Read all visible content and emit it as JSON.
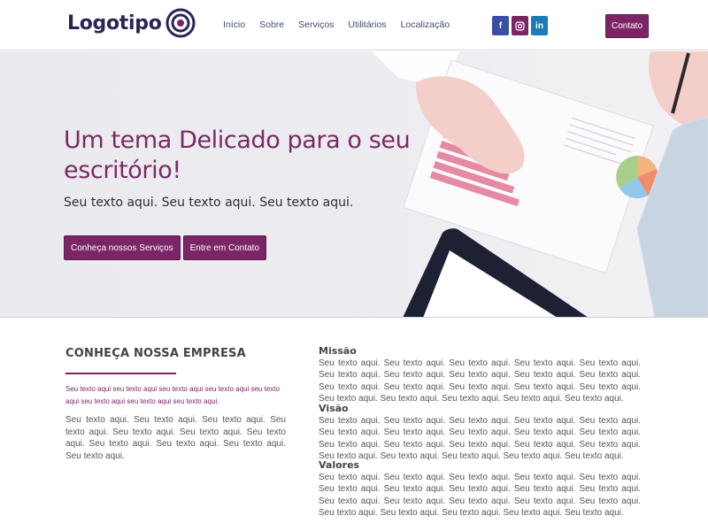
{
  "header": {
    "logo_text": "Logotipo",
    "nav": [
      "Início",
      "Sobre",
      "Serviços",
      "Utilitários",
      "Localização"
    ],
    "social": [
      {
        "icon": "facebook-icon",
        "glyph": "f"
      },
      {
        "icon": "instagram-icon",
        "glyph": ""
      },
      {
        "icon": "linkedin-icon",
        "glyph": "in"
      }
    ],
    "contact_label": "Contato"
  },
  "hero": {
    "title": "Um tema Delicado para o seu escritório!",
    "subtitle": "Seu texto aqui. Seu texto aqui. Seu texto aqui.",
    "btn_services": "Conheça nossos Serviços",
    "btn_contact": "Entre em Contato"
  },
  "about": {
    "title": "CONHEÇA NOSSA EMPRESA",
    "lead": "Seu texto aqui seu texto aqui seu texto aqui seu texto aqui seu texto aqui seu texto aqui seu texto aqui seu texto aqui.",
    "body": "Seu texto aqui. Seu texto aqui. Seu texto aqui. Seu texto aqui. Seu texto aqui. Seu texto aqui. Seu texto aqui. Seu texto aqui. Seu texto aqui. Seu texto aqui. Seu texto aqui.",
    "missao_title": "Missão",
    "missao_text": "Seu texto aqui. Seu texto aqui. Seu texto aqui. Seu texto aqui. Seu texto aqui. Seu texto aqui. Seu texto aqui. Seu texto aqui. Seu texto aqui. Seu texto aqui. Seu texto aqui. Seu texto aqui. Seu texto aqui. Seu texto aqui. Seu texto aqui. Seu texto aqui. Seu texto aqui. Seu texto aqui. Seu texto aqui. Seu texto aqui.",
    "visao_title": "Visão",
    "visao_text": "Seu texto aqui. Seu texto aqui. Seu texto aqui. Seu texto aqui. Seu texto aqui. Seu texto aqui. Seu texto aqui. Seu texto aqui. Seu texto aqui. Seu texto aqui. Seu texto aqui. Seu texto aqui. Seu texto aqui. Seu texto aqui. Seu texto aqui. Seu texto aqui. Seu texto aqui. Seu texto aqui. Seu texto aqui. Seu texto aqui.",
    "valores_title": "Valores",
    "valores_text": "Seu texto aqui. Seu texto aqui. Seu texto aqui. Seu texto aqui. Seu texto aqui. Seu texto aqui. Seu texto aqui. Seu texto aqui. Seu texto aqui. Seu texto aqui. Seu texto aqui. Seu texto aqui. Seu texto aqui. Seu texto aqui. Seu texto aqui. Seu texto aqui. Seu texto aqui. Seu texto aqui. Seu texto aqui. Seu texto aqui."
  },
  "colors": {
    "brand": "#7b2567",
    "logo": "#2b2458",
    "facebook": "#3b4ea5",
    "instagram": "#7b2567",
    "linkedin": "#1d7bb8"
  }
}
